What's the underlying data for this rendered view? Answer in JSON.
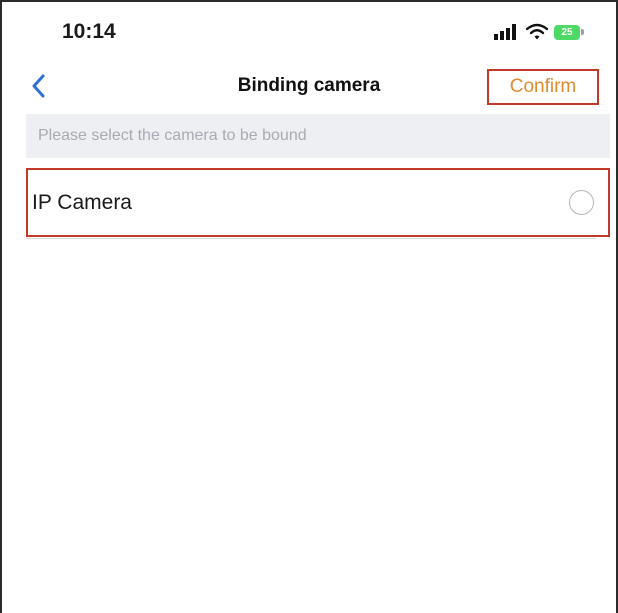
{
  "status_bar": {
    "time": "10:14",
    "battery": "25",
    "icons": [
      "signal-icon",
      "wifi-icon",
      "battery-icon"
    ]
  },
  "nav": {
    "back_icon": "chevron-left-icon",
    "title": "Binding camera",
    "confirm_label": "Confirm"
  },
  "hint": {
    "text": "Please select the camera to be bound"
  },
  "cameras": [
    {
      "label": "IP Camera",
      "selected": false
    }
  ],
  "colors": {
    "accent_blue": "#2f6fd8",
    "confirm_text": "#e08a2e",
    "highlight_border": "#c0392b",
    "hint_background": "#eeeff3",
    "hint_text": "#a8abb3",
    "battery_green": "#4cd964"
  }
}
